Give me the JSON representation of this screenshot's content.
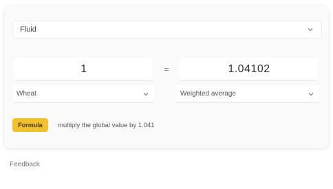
{
  "converter": {
    "unit_type": "Fluid",
    "from_value": "1",
    "equals": "=",
    "to_value": "1.04102",
    "from_unit": "Wheat",
    "to_unit": "Weighted average",
    "formula_label": "Formula",
    "formula_text": "multiply the global value by 1.041"
  },
  "footer": {
    "feedback": "Feedback"
  },
  "icons": {
    "dropdown": "chevron-down-icon"
  }
}
